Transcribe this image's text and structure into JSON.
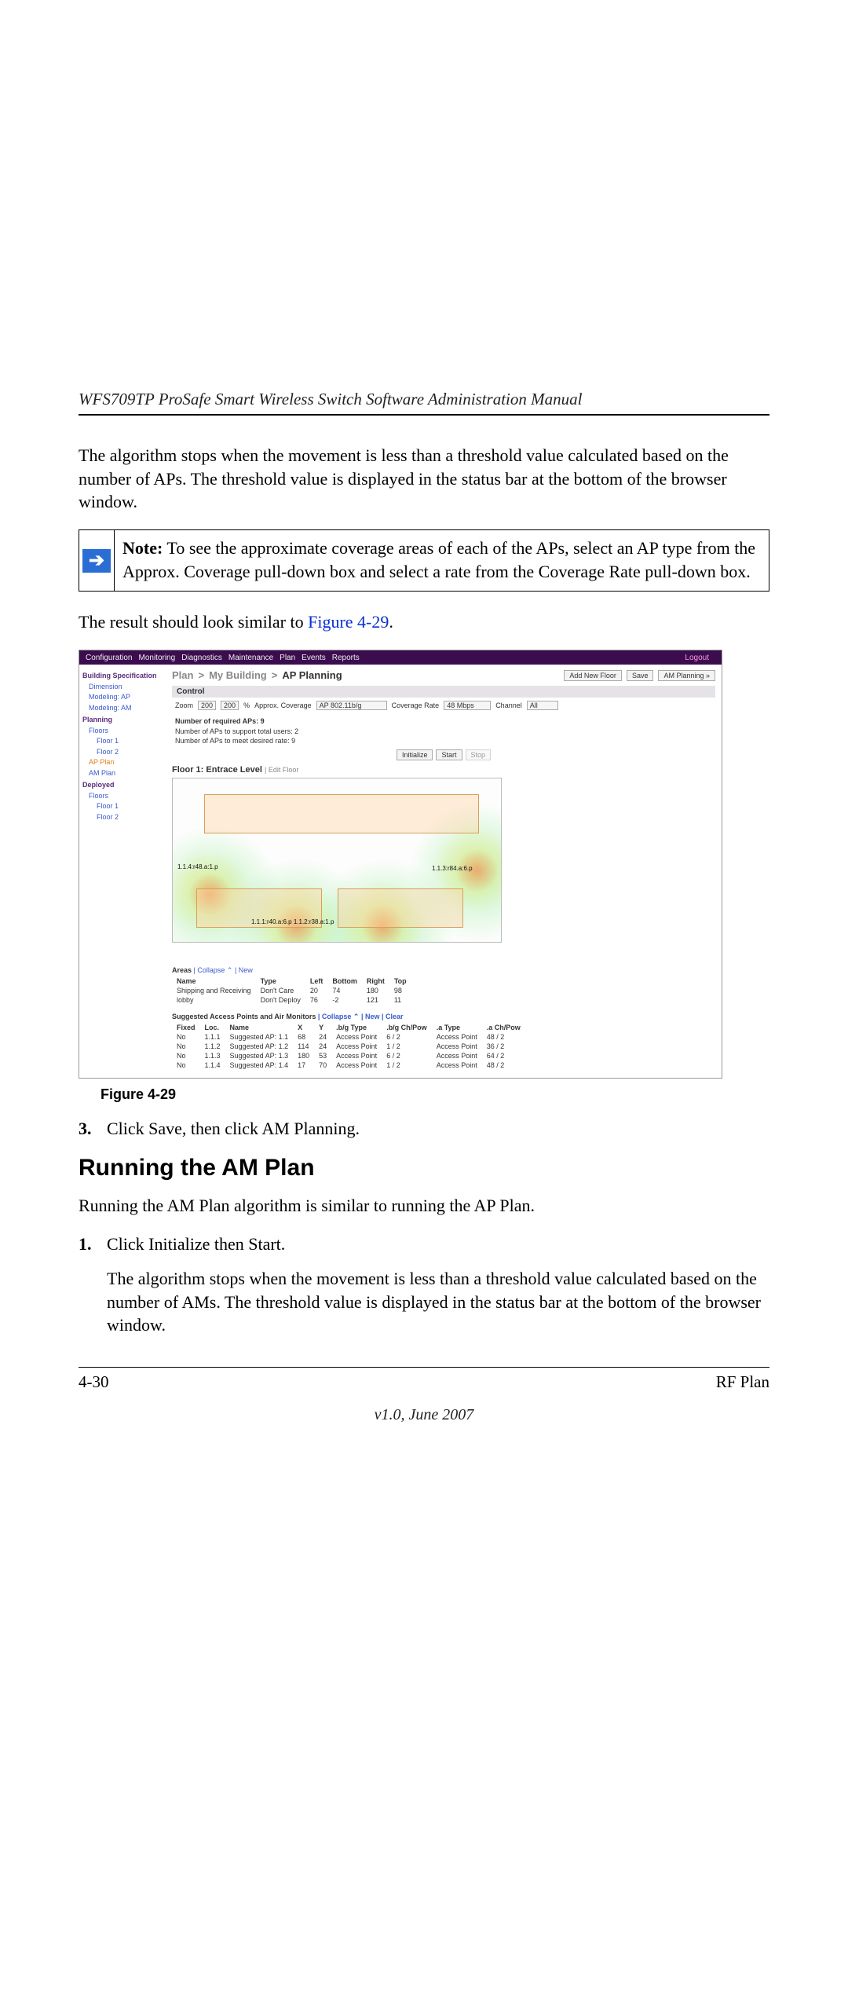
{
  "doc_header": "WFS709TP ProSafe Smart Wireless Switch Software Administration Manual",
  "para_intro": "The algorithm stops when the movement is less than a threshold value calculated based on the number of APs. The threshold value is displayed in the status bar at the bottom of the browser window.",
  "note": {
    "label": "Note:",
    "text": "To see the approximate coverage areas of each of the APs, select an AP type from the Approx. Coverage pull-down box and select a rate from the Coverage Rate pull-down box."
  },
  "result_prefix": "The result should look similar to ",
  "result_link": "Figure 4-29",
  "result_suffix": ".",
  "screenshot": {
    "topnav": {
      "items": [
        "Configuration",
        "Monitoring",
        "Diagnostics",
        "Maintenance",
        "Plan",
        "Events",
        "Reports"
      ],
      "logout": "Logout"
    },
    "sidebar": {
      "sec1_title": "Building Specification",
      "sec1_items": [
        "Dimension",
        "Modeling: AP",
        "Modeling: AM"
      ],
      "sec2_title": "Planning",
      "sec2_floors": "Floors",
      "sec2_floor1": "Floor 1",
      "sec2_floor2": "Floor 2",
      "sec2_applan": "AP Plan",
      "sec2_amplan": "AM Plan",
      "sec3_title": "Deployed",
      "sec3_floors": "Floors",
      "sec3_floor1": "Floor 1",
      "sec3_floor2": "Floor 2"
    },
    "breadcrumb": {
      "a": "Plan",
      "b": "My Building",
      "c": "AP Planning"
    },
    "btn_add_floor": "Add New Floor",
    "btn_save": "Save",
    "btn_am_planning": "AM Planning »",
    "control_title": "Control",
    "zoom_label": "Zoom",
    "zoom_value": "200",
    "zoom_pct_value": "200",
    "zoom_pct_suffix": "%",
    "approx_label": "Approx. Coverage",
    "ap_type": "AP  802.11b/g",
    "rate_label": "Coverage Rate",
    "rate_value": "48 Mbps",
    "channel_label": "Channel",
    "channel_value": "All",
    "req_title": "Number of required APs: 9",
    "req_line1": "Number of APs to support total users: 2",
    "req_line2": "Number of APs to meet desired rate: 9",
    "btn_initialize": "Initialize",
    "btn_start": "Start",
    "btn_stop": "Stop",
    "floor_title": "Floor 1: Entrace Level",
    "floor_edit": "| Edit Floor",
    "ap_labels": {
      "a": "1.1.4:r48.a:1.p",
      "b": "1.1.3:r84.a:6.p",
      "c": "1.1.1:r40.a:6.p 1.1.2:r38.a:1.p"
    },
    "areas_header": "Areas | Collapse  | New",
    "areas_cols": [
      "Name",
      "Type",
      "Left",
      "Bottom",
      "Right",
      "Top"
    ],
    "areas_rows": [
      [
        "Shipping and Receiving",
        "Don't Care",
        "20",
        "74",
        "180",
        "98"
      ],
      [
        "lobby",
        "Don't Deploy",
        "76",
        "-2",
        "121",
        "11"
      ]
    ],
    "sugg_header": "Suggested Access Points and Air Monitors | Collapse  | New | Clear",
    "sugg_cols": [
      "Fixed",
      "Loc.",
      "Name",
      "X",
      "Y",
      ".b/g Type",
      ".b/g Ch/Pow",
      ".a Type",
      ".a Ch/Pow"
    ],
    "sugg_rows": [
      [
        "No",
        "1.1.1",
        "Suggested AP: 1.1",
        "68",
        "24",
        "Access Point",
        "6 / 2",
        "Access Point",
        "48 / 2"
      ],
      [
        "No",
        "1.1.2",
        "Suggested AP: 1.2",
        "114",
        "24",
        "Access Point",
        "1 / 2",
        "Access Point",
        "36 / 2"
      ],
      [
        "No",
        "1.1.3",
        "Suggested AP: 1.3",
        "180",
        "53",
        "Access Point",
        "6 / 2",
        "Access Point",
        "64 / 2"
      ],
      [
        "No",
        "1.1.4",
        "Suggested AP: 1.4",
        "17",
        "70",
        "Access Point",
        "1 / 2",
        "Access Point",
        "48 / 2"
      ]
    ]
  },
  "figure_caption": "Figure 4-29",
  "step3_num": "3.",
  "step3_text": "Click Save, then click AM Planning.",
  "h2": "Running the AM Plan",
  "am_intro": "Running the AM Plan algorithm is similar to running the AP Plan.",
  "step1_num": "1.",
  "step1_text": "Click Initialize then Start.",
  "am_para": "The algorithm stops when the movement is less than a threshold value calculated based on the number of AMs. The threshold value is displayed in the status bar at the bottom of the browser window.",
  "footer_left": "4-30",
  "footer_right": "RF Plan",
  "version": "v1.0, June 2007"
}
